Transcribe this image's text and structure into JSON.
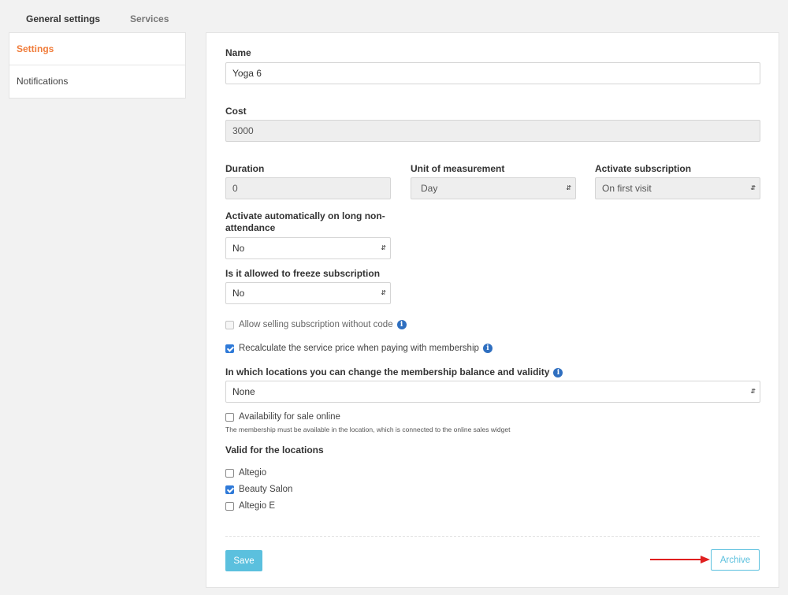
{
  "tabs": {
    "general": "General settings",
    "services": "Services"
  },
  "sidebar": {
    "items": [
      {
        "label": "Settings"
      },
      {
        "label": "Notifications"
      }
    ]
  },
  "form": {
    "name_label": "Name",
    "name_value": "Yoga 6",
    "cost_label": "Cost",
    "cost_value": "3000",
    "duration_label": "Duration",
    "duration_value": "0",
    "unit_label": "Unit of measurement",
    "unit_value": "Day",
    "activate_label": "Activate subscription",
    "activate_value": "On first visit",
    "auto_label_1": "Activate automatically on long non-",
    "auto_label_2": "attendance",
    "auto_value": "No",
    "freeze_label": "Is it allowed to freeze subscription",
    "freeze_value": "No",
    "allow_selling": "Allow selling subscription without code",
    "recalculate": "Recalculate the service price when paying with membership",
    "locations_balance_label": "In which locations you can change the membership balance and validity",
    "locations_balance_value": "None",
    "online_label": "Availability for sale online",
    "online_hint": "The membership must be available in the location, which is connected to the online sales widget",
    "valid_label": "Valid for the locations",
    "locations": [
      {
        "label": "Altegio",
        "checked": false
      },
      {
        "label": "Beauty Salon",
        "checked": true
      },
      {
        "label": "Altegio E",
        "checked": false
      }
    ]
  },
  "buttons": {
    "save": "Save",
    "archive": "Archive"
  },
  "colors": {
    "accent_orange": "#f07c3a",
    "primary_blue": "#5bc0de",
    "checkbox_blue": "#2f7ad8",
    "arrow_red": "#e02020"
  },
  "icons": {
    "info": "info-icon",
    "select_arrow": "updown-arrow-icon"
  }
}
